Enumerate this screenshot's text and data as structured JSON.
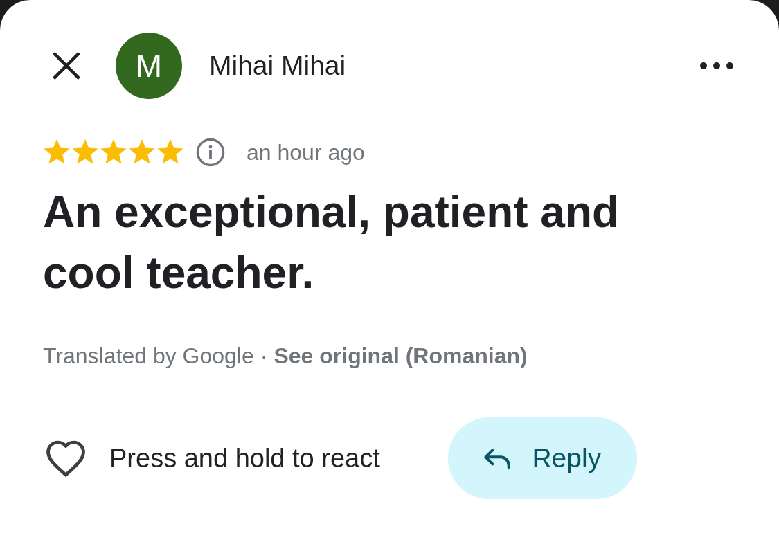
{
  "header": {
    "author": {
      "initial": "M",
      "name": "Mihai Mihai"
    }
  },
  "review": {
    "stars": 5,
    "time": "an hour ago",
    "text": "An exceptional, patient and cool teacher.",
    "translation": {
      "note": "Translated by Google",
      "separator": "·",
      "link": "See original (Romanian)"
    }
  },
  "actions": {
    "react_label": "Press and hold to react",
    "reply_button": "Reply"
  }
}
